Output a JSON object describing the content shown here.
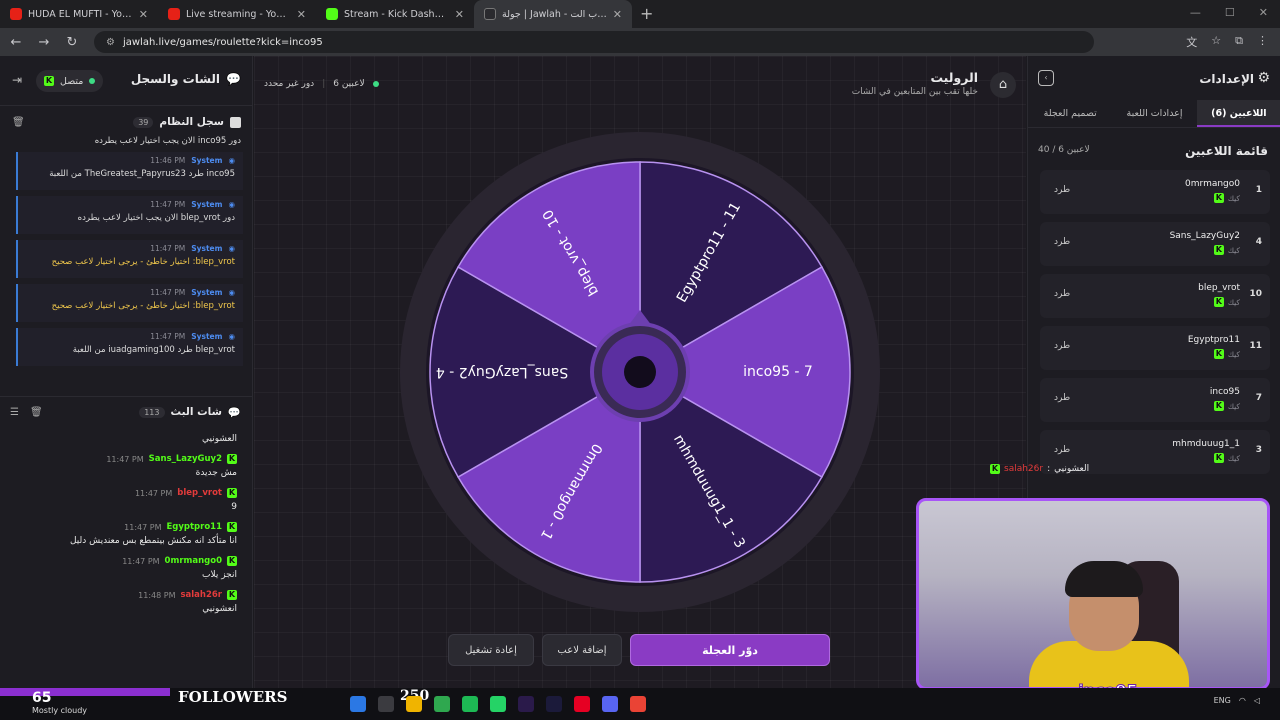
{
  "browser": {
    "tabs": [
      {
        "title": "HUDA EL MUFTI - YouTube",
        "icon": "youtube-icon",
        "active": false
      },
      {
        "title": "Live streaming - YouTube Studio",
        "icon": "youtube-icon",
        "active": false
      },
      {
        "title": "Stream - Kick Dashboard",
        "icon": "kick-icon",
        "active": false
      },
      {
        "title": "جولة | Jawlah - منصة الألعاب الت...",
        "icon": "jawlah-icon",
        "active": true
      }
    ],
    "url": "jawlah.live/games/roulette?kick=inco95"
  },
  "left_panel": {
    "title": "الشات والسجل",
    "connection": "متصل",
    "system_log": {
      "title": "سجل النظام",
      "count": "39",
      "first_line": "دور inco95 الان يجب اختيار لاعب يطرده",
      "items": [
        {
          "time": "11:46 PM",
          "user": "System",
          "text": "inco95 طرد TheGreatest_Papyrus23 من اللعبة",
          "warn": false
        },
        {
          "time": "11:47 PM",
          "user": "System",
          "text": "دور blep_vrot الان يجب اختيار لاعب يطرده",
          "warn": false
        },
        {
          "time": "11:47 PM",
          "user": "System",
          "text": "blep_vrot: اختيار خاطئ - يرجى اختيار لاعب صحيح",
          "warn": true
        },
        {
          "time": "11:47 PM",
          "user": "System",
          "text": "blep_vrot: اختيار خاطئ - يرجى اختيار لاعب صحيح",
          "warn": true
        },
        {
          "time": "11:47 PM",
          "user": "System",
          "text": "blep_vrot طرد iuadgaming100 من اللعبة",
          "warn": false
        }
      ]
    },
    "live_chat": {
      "title": "شات البث",
      "count": "113",
      "first_line": "العشونيي",
      "messages": [
        {
          "time": "11:47 PM",
          "user": "Sans_LazyGuy2",
          "color": "#53fc18",
          "text": "مش جديدة"
        },
        {
          "time": "11:47 PM",
          "user": "blep_vrot",
          "color": "#e23b3b",
          "text": "9"
        },
        {
          "time": "11:47 PM",
          "user": "Egyptpro11",
          "color": "#53fc18",
          "text": "انا متأكد انه مكنش بيتمطع بس معنديش دليل"
        },
        {
          "time": "11:47 PM",
          "user": "0mrmango0",
          "color": "#53fc18",
          "text": "انجز يلاب"
        },
        {
          "time": "11:48 PM",
          "user": "salah26r",
          "color": "#e23b3b",
          "text": "انعشونيي"
        }
      ]
    }
  },
  "center": {
    "title": "الروليت",
    "subtitle": "خلها تقب بين المتابعين في الشات",
    "players_status": "6 لاعبين",
    "turn_status": "دور غير محدد",
    "wheel": {
      "segments": [
        {
          "label": "Egyptpro11 - 11",
          "color": "#2d1a54"
        },
        {
          "label": "inco95 - 7",
          "color": "#7a3fc4"
        },
        {
          "label": "mhmduuug1_1 - 3",
          "color": "#2d1a54"
        },
        {
          "label": "0mrmango0 - 1",
          "color": "#7a3fc4"
        },
        {
          "label": "Sans_LazyGuy2 - 4",
          "color": "#2d1a54"
        },
        {
          "label": "blep_vrot - 10",
          "color": "#7a3fc4"
        }
      ]
    },
    "buttons": {
      "spin": "دوّر العجلة",
      "add": "إضافة لاعب",
      "reset": "إعادة تشغيل"
    }
  },
  "right_panel": {
    "title": "الإعدادات",
    "tabs": [
      {
        "label": "اللاعبين (6)",
        "active": true
      },
      {
        "label": "إعدادات اللعبة",
        "active": false
      },
      {
        "label": "تصميم العجلة",
        "active": false
      }
    ],
    "list_title": "قائمة اللاعبين",
    "list_count": "40 / 6 لاعبين",
    "kick_label": "طرد",
    "platform_label": "كيك",
    "players": [
      {
        "num": "1",
        "name": "0mrmango0"
      },
      {
        "num": "4",
        "name": "Sans_LazyGuy2"
      },
      {
        "num": "10",
        "name": "blep_vrot"
      },
      {
        "num": "11",
        "name": "Egyptpro11"
      },
      {
        "num": "7",
        "name": "inco95"
      },
      {
        "num": "3",
        "name": "mhmduuug1_1"
      }
    ]
  },
  "overlay": {
    "float_user": "salah26r",
    "float_text": "العشونيي",
    "cam_name": "inco95",
    "weather_temp": "65",
    "weather_text": "Mostly cloudy",
    "followers_label": "FOLLOWERS",
    "followers_count": "250",
    "lang": "ENG"
  },
  "colors": {
    "accent": "#8a3bc4",
    "kick_green": "#53fc18",
    "system_blue": "#3a7bd5",
    "warn": "#f2c94c"
  }
}
